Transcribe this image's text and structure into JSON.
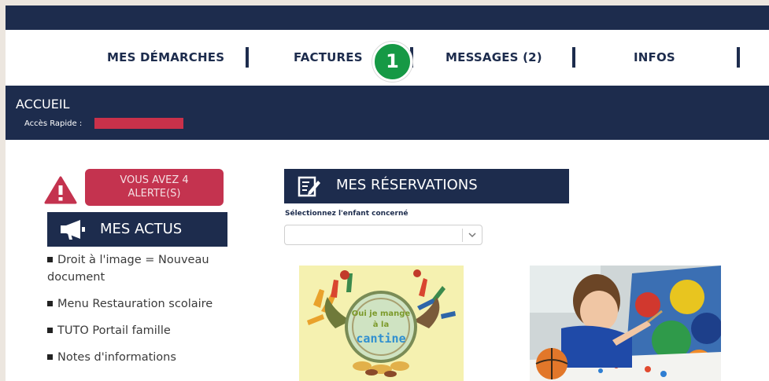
{
  "nav": {
    "items": [
      {
        "label": "MES DÉMARCHES"
      },
      {
        "label": "FACTURES"
      },
      {
        "label": "MESSAGES (2)"
      },
      {
        "label": "INFOS"
      }
    ],
    "callout_number": "1"
  },
  "header": {
    "title": "ACCUEIL",
    "quick_access_label": "Accès Rapide :"
  },
  "alerts": {
    "button_line1": "VOUS AVEZ 4",
    "button_line2": "ALERTE(S)"
  },
  "actus": {
    "title": "MES ACTUS",
    "items": [
      {
        "label": "Droit à l'image = Nouveau document"
      },
      {
        "label": "Menu Restauration scolaire"
      },
      {
        "label": "TUTO Portail famille"
      },
      {
        "label": "Notes d'informations"
      }
    ]
  },
  "reservations": {
    "title": "MES RÉSERVATIONS",
    "child_label": "Sélectionnez l'enfant concerné",
    "select_value": "",
    "card1_text_line1": "Oui je mange",
    "card1_text_line2": "à la",
    "card1_text_line3": "cantine"
  },
  "colors": {
    "navy": "#1d2c4d",
    "alert_red": "#c4334f",
    "callout_green": "#169945"
  }
}
